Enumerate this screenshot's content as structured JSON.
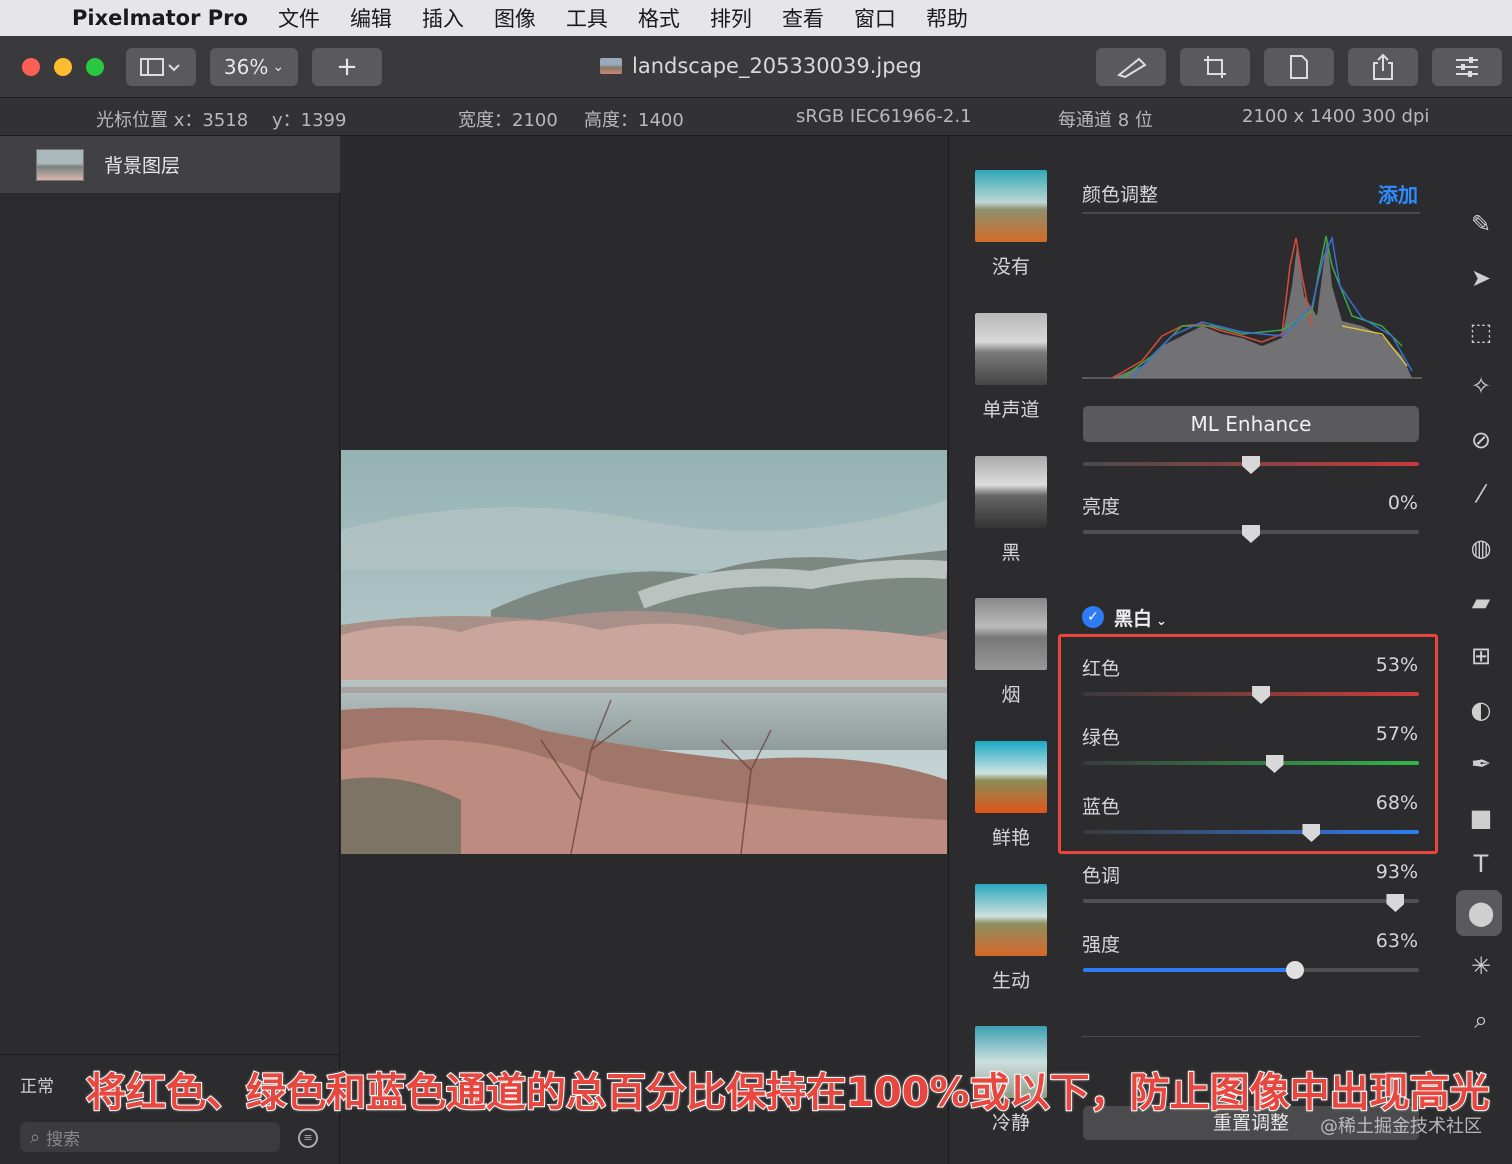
{
  "menubar": {
    "apple_icon": "",
    "app_name": "Pixelmator Pro",
    "items": [
      "文件",
      "编辑",
      "插入",
      "图像",
      "工具",
      "格式",
      "排列",
      "查看",
      "窗口",
      "帮助"
    ]
  },
  "toolbar": {
    "zoom": "36%",
    "add_label": "+",
    "document_title": "landscape_205330039.jpeg"
  },
  "infobar": {
    "cursor_x": "光标位置 x：3518",
    "cursor_y": "y：1399",
    "width": "宽度：2100",
    "height": "高度：1400",
    "profile": "sRGB IEC61966-2.1",
    "depth": "每通道 8 位",
    "size": "2100 x 1400 300 dpi"
  },
  "layers": {
    "layer_name": "背景图层",
    "blend_mode": "正常",
    "search_placeholder": "搜索"
  },
  "presets": [
    "没有",
    "单声道",
    "黑",
    "烟",
    "鲜艳",
    "生动",
    "冷静"
  ],
  "adjust": {
    "title": "颜色调整",
    "add": "添加",
    "ml_enhance": "ML Enhance",
    "brightness_label": "亮度",
    "brightness_value": "0%",
    "brightness": 0.5,
    "bw_label": "黑白",
    "red_label": "红色",
    "red_value": "53%",
    "red": 0.53,
    "green_label": "绿色",
    "green_value": "57%",
    "green": 0.57,
    "blue_label": "蓝色",
    "blue_value": "68%",
    "blue": 0.68,
    "tone_label": "色调",
    "tone_value": "93%",
    "tone": 0.93,
    "strength_label": "强度",
    "strength_value": "63%",
    "strength": 0.63,
    "reset": "重置调整"
  },
  "annotation": "将红色、绿色和蓝色通道的总百分比保持在100%或以下，防止图像中出现高光",
  "watermark": "@稀土掘金技术社区",
  "colors": {
    "accent": "#2d7cf6",
    "highlight": "#e8473f"
  }
}
